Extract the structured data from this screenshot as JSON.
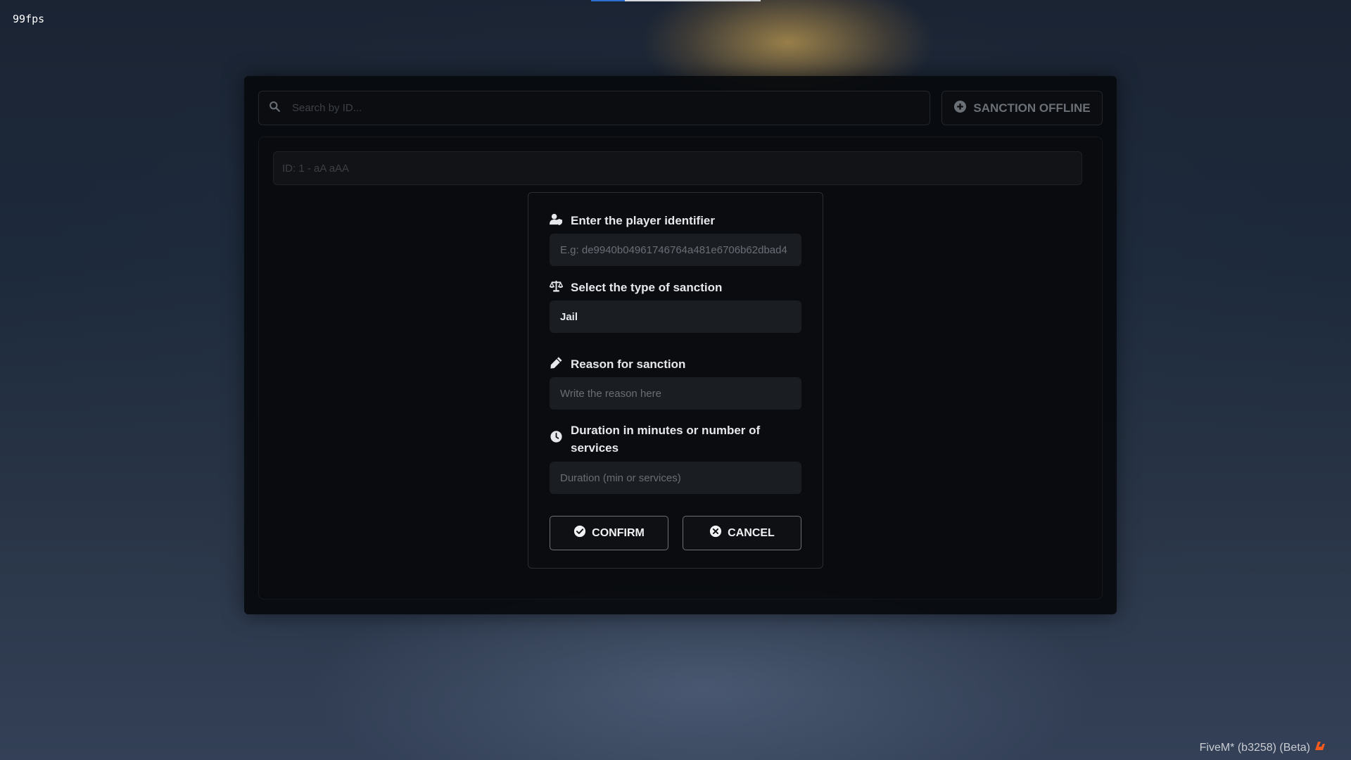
{
  "overlay": {
    "fps_counter": "99fps",
    "build_label": "FiveM* (b3258) (Beta)",
    "fivem_logo_icon": "fivem-logo-icon"
  },
  "panel": {
    "search": {
      "placeholder": "Search by ID...",
      "value": "",
      "icon": "search-icon"
    },
    "sanction_offline_button": {
      "label": "SANCTION OFFLINE",
      "icon": "plus-circle-icon"
    },
    "player_list": [
      {
        "label": "ID: 1 - aA aAA"
      }
    ]
  },
  "modal": {
    "identifier": {
      "label": "Enter the player identifier",
      "placeholder": "E.g: de9940b04961746764a481e6706b62dbad4",
      "value": "",
      "icon": "user-shield-icon"
    },
    "sanction_type": {
      "label": "Select the type of sanction",
      "selected": "Jail",
      "icon": "scale-icon"
    },
    "reason": {
      "label": "Reason for sanction",
      "placeholder": "Write the reason here",
      "value": "",
      "icon": "pen-icon"
    },
    "duration": {
      "label": "Duration in minutes or number of services",
      "placeholder": "Duration (min or services)",
      "value": "",
      "icon": "clock-icon"
    },
    "confirm_button": {
      "label": "CONFIRM",
      "icon": "check-circle-icon"
    },
    "cancel_button": {
      "label": "CANCEL",
      "icon": "x-circle-icon"
    }
  },
  "colors": {
    "panel_bg": "#07090c",
    "field_bg": "#1a1d22",
    "accent_progress": "#2d6fd1",
    "fivem_orange": "#f25b1d"
  }
}
